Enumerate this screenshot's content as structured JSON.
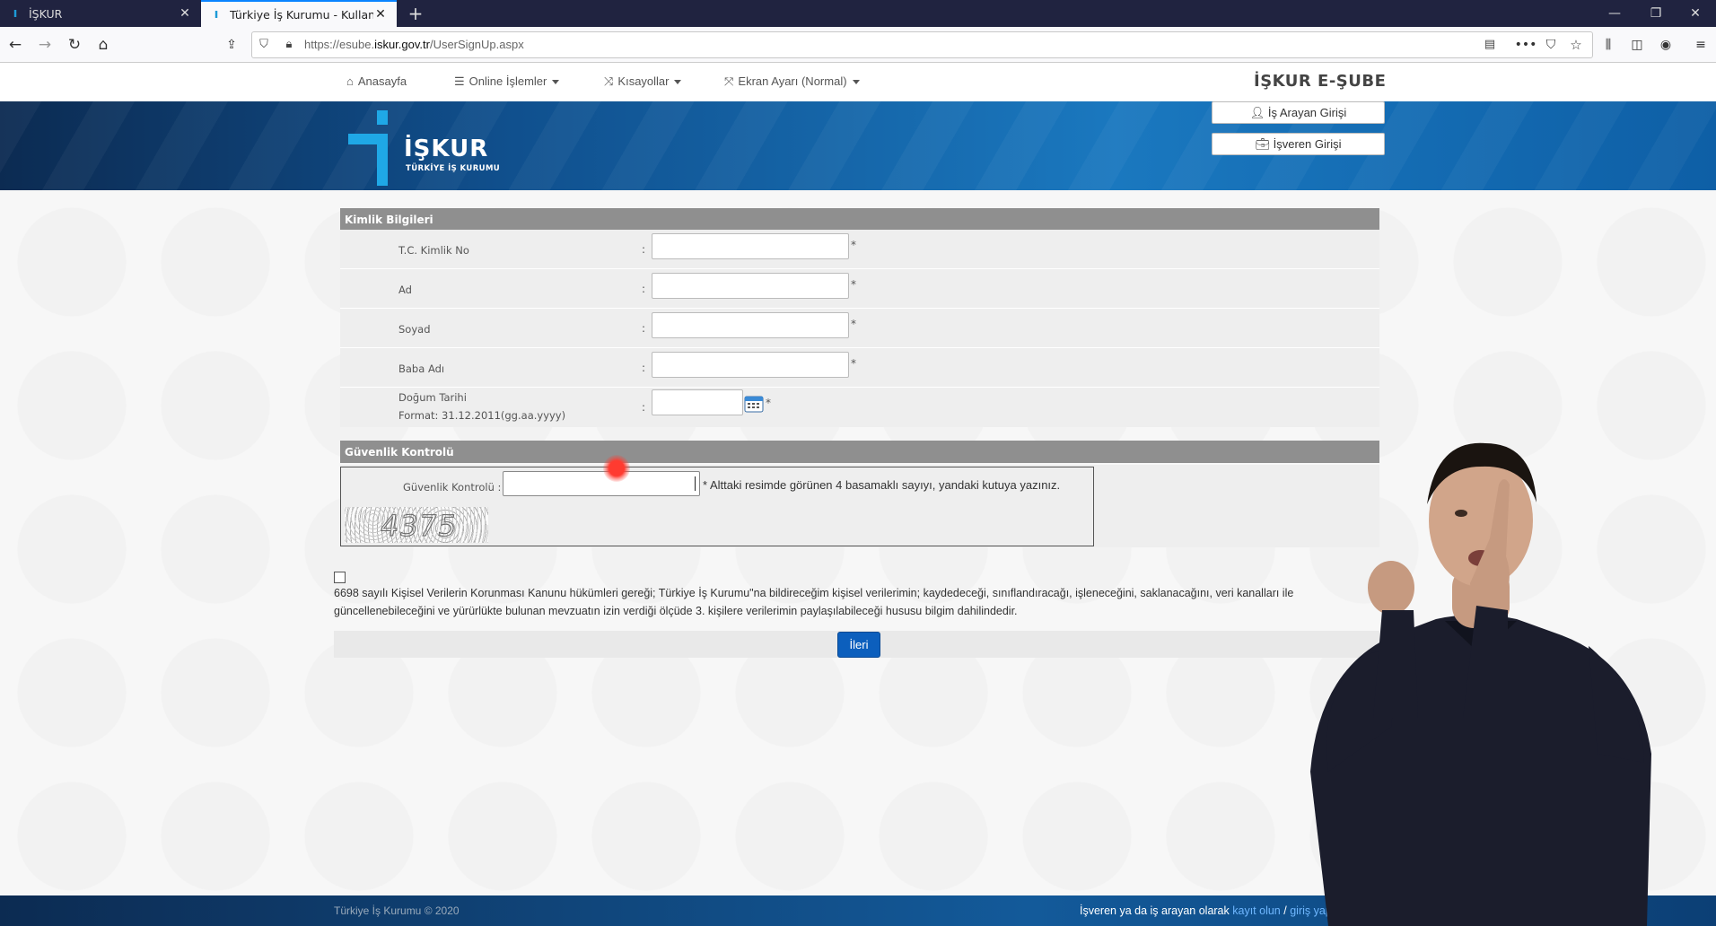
{
  "browser": {
    "tabs": [
      {
        "title": "İŞKUR",
        "active": false
      },
      {
        "title": "Türkiye İş Kurumu - Kullanıcı K",
        "active": true
      }
    ],
    "url_prefix": "https://esube.",
    "url_domain": "iskur.gov.tr",
    "url_path": "/UserSignUp.aspx"
  },
  "site": {
    "menu": [
      {
        "icon": "home-icon",
        "label": "Anasayfa"
      },
      {
        "icon": "list-icon",
        "label": "Online İşlemler"
      },
      {
        "icon": "shuffle-icon",
        "label": "Kısayollar"
      },
      {
        "icon": "resize-icon",
        "label": "Ekran Ayarı (Normal)"
      }
    ],
    "brand": "İŞKUR E-ŞUBE",
    "logo_text": "İŞKUR",
    "logo_sub": "TÜRKİYE İŞ KURUMU",
    "login_seeker": "İş Arayan Girişi",
    "login_employer": "İşveren Girişi"
  },
  "form": {
    "identity_title": "Kimlik Bilgileri",
    "fields": [
      {
        "label": "T.C. Kimlik No",
        "value": ""
      },
      {
        "label": "Ad",
        "value": ""
      },
      {
        "label": "Soyad",
        "value": ""
      },
      {
        "label": "Baba Adı",
        "value": ""
      }
    ],
    "birth_label": "Doğum Tarihi",
    "birth_format": "Format: 31.12.2011(gg.aa.yyyy)",
    "colon": ":",
    "required": "*",
    "security_title": "Güvenlik Kontrolü",
    "security_label": "Güvenlik Kontrolü :",
    "security_hint": "* Alttaki resimde görünen 4 basamaklı sayıyı, yandaki kutuya yazınız.",
    "captcha": "4375",
    "kvkk": "6698 sayılı Kişisel Verilerin Korunması Kanunu hükümleri gereği; Türkiye İş Kurumu\"na bildireceğim kişisel verilerimin; kaydedeceği, sınıflandıracağı, işleneceğini, saklanacağını, veri kanalları ile güncellenebileceğini ve yürürlükte bulunan mevzuatın izin verdiği ölçüde 3. kişilere verilerimin paylaşılabileceği hususu bilgim dahilindedir.",
    "next": "İleri"
  },
  "footer": {
    "copyright": "Türkiye İş Kurumu © 2020",
    "prefix": "İşveren ya da iş arayan olarak",
    "register": "kayıt olun",
    "sep": "/",
    "login": "giriş yapı"
  }
}
